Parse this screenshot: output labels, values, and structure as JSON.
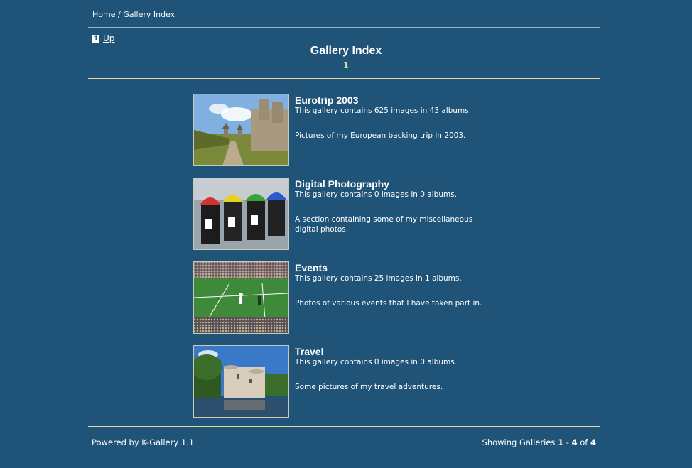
{
  "breadcrumb": {
    "home_label": "Home",
    "separator": "/",
    "current": "Gallery Index"
  },
  "nav": {
    "up_label": "Up",
    "up_icon": "up-arrow-icon"
  },
  "header": {
    "title": "Gallery Index",
    "page_number": "1"
  },
  "galleries": [
    {
      "title": "Eurotrip 2003",
      "count_text": "This gallery contains 625 images in 43 albums.",
      "description": "Pictures of my European backing trip in 2003."
    },
    {
      "title": "Digital Photography",
      "count_text": "This gallery contains 0 images in 0 albums.",
      "description": "A section containing some of my miscellaneous digital photos."
    },
    {
      "title": "Events",
      "count_text": "This gallery contains 25 images in 1 albums.",
      "description": "Photos of various events that I have taken part in."
    },
    {
      "title": "Travel",
      "count_text": "This gallery contains 0 images in 0 albums.",
      "description": "Some pictures of my travel adventures."
    }
  ],
  "footer": {
    "powered_by": "Powered by K-Gallery 1.1",
    "showing_prefix": "Showing Galleries",
    "range_start": "1",
    "range_sep": "-",
    "range_end": "4",
    "of_label": "of",
    "total": "4"
  },
  "colors": {
    "background": "#1f5378",
    "rule_gold": "#e6dca0",
    "rule_blue": "#8fb7d6",
    "text": "#ffffff"
  }
}
